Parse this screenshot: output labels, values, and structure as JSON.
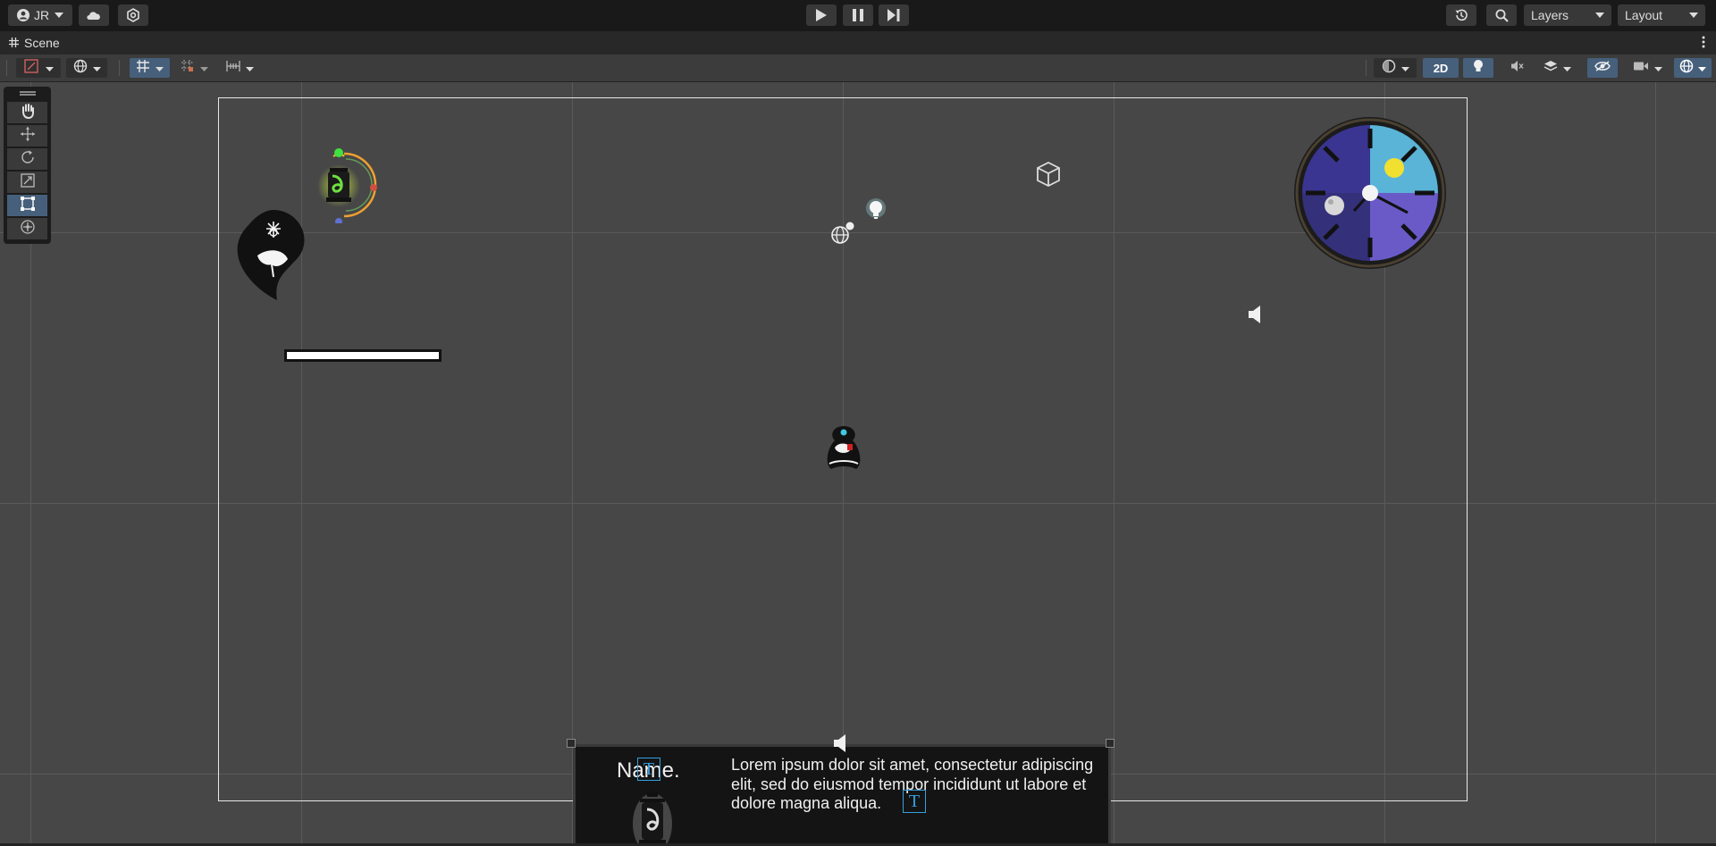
{
  "topbar": {
    "account_label": "JR",
    "layers_label": "Layers",
    "layout_label": "Layout"
  },
  "tab": {
    "title": "Scene"
  },
  "scene_toolbar": {
    "mode_2d_label": "2D"
  },
  "dialog": {
    "name": "Name.",
    "text": "Lorem ipsum dolor sit amet, consectetur adipiscing elit, sed do eiusmod tempor incididunt ut labore et dolore magna aliqua."
  },
  "colors": {
    "toolbar_active": "#46607c",
    "topbar_bg": "#191919",
    "scene_bg": "#474747"
  }
}
